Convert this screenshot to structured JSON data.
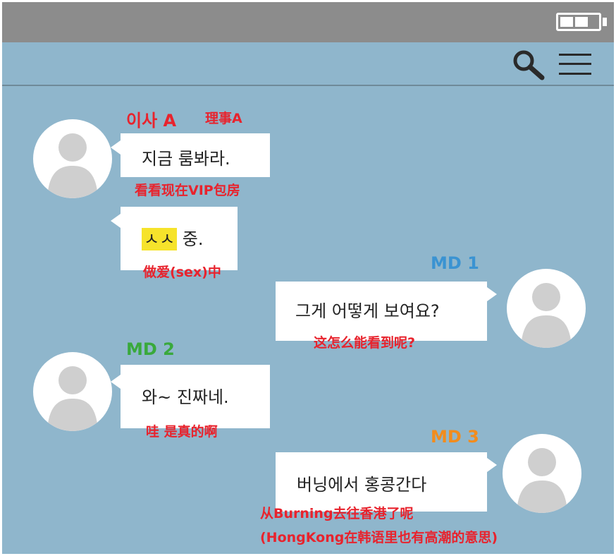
{
  "status_bar": {
    "battery_icon": "battery-icon",
    "bar_color": "#8c8c8c"
  },
  "app_bar": {
    "icons": [
      "search-icon",
      "menu-icon"
    ],
    "background": "#8fb6cc"
  },
  "colors": {
    "annotation": "#e8232d",
    "md1": "#3a93d2",
    "md2": "#39a93c",
    "md3": "#f28c1d",
    "highlight": "#f6e32b"
  },
  "messages": [
    {
      "sender": "이사 A",
      "sender_note": "理事A",
      "side": "left",
      "bubbles": [
        {
          "text": "지금 룸봐라.",
          "translation": "看看现在VIP包房"
        },
        {
          "highlight": "ㅅㅅ",
          "text": " 중.",
          "translation": "做爱(sex)中"
        }
      ]
    },
    {
      "sender": "MD 1",
      "side": "right",
      "bubbles": [
        {
          "text": "그게 어떻게 보여요?",
          "translation": "这怎么能看到呢?"
        }
      ]
    },
    {
      "sender": "MD 2",
      "side": "left",
      "bubbles": [
        {
          "text": "와~ 진짜네.",
          "translation": "哇 是真的啊"
        }
      ]
    },
    {
      "sender": "MD 3",
      "side": "right",
      "bubbles": [
        {
          "text": "버닝에서 홍콩간다",
          "translation": "从Burning去往香港了呢",
          "translation_2": "(HongKong在韩语里也有高潮的意思)"
        }
      ]
    }
  ]
}
